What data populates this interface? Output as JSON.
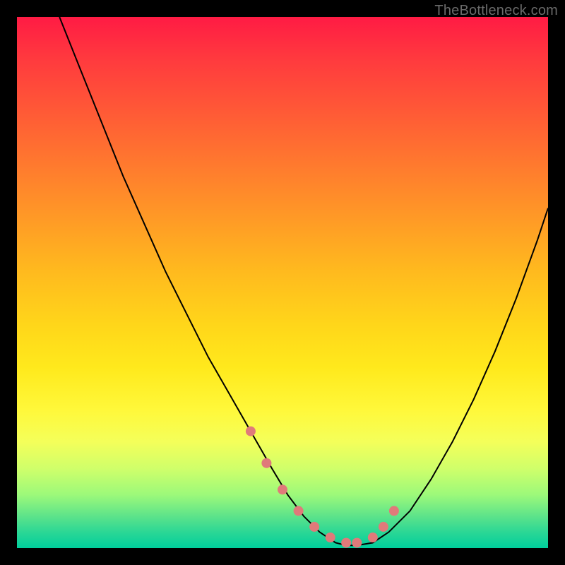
{
  "watermark": "TheBottleneck.com",
  "chart_data": {
    "type": "line",
    "title": "",
    "xlabel": "",
    "ylabel": "",
    "xlim": [
      0,
      100
    ],
    "ylim": [
      0,
      100
    ],
    "grid": false,
    "legend": false,
    "annotations": [],
    "series": [
      {
        "name": "bottleneck-curve",
        "color": "#000000",
        "x": [
          8,
          12,
          16,
          20,
          24,
          28,
          32,
          36,
          40,
          44,
          48,
          51,
          54,
          57,
          60,
          62,
          64,
          67,
          70,
          74,
          78,
          82,
          86,
          90,
          94,
          98,
          100
        ],
        "y": [
          100,
          90,
          80,
          70,
          61,
          52,
          44,
          36,
          29,
          22,
          15,
          10,
          6,
          3,
          1,
          0.5,
          0.5,
          1,
          3,
          7,
          13,
          20,
          28,
          37,
          47,
          58,
          64
        ]
      }
    ],
    "markers": {
      "name": "highlight-points",
      "color": "#e07a7a",
      "x": [
        44,
        47,
        50,
        53,
        56,
        59,
        62,
        64,
        67,
        69,
        71
      ],
      "y": [
        22,
        16,
        11,
        7,
        4,
        2,
        1,
        1,
        2,
        4,
        7
      ]
    },
    "background_gradient": {
      "top_color": "#ff1b44",
      "bottom_color": "#00ce9c",
      "description": "vertical red-to-green gradient (red=high bottleneck, green=low)"
    }
  }
}
